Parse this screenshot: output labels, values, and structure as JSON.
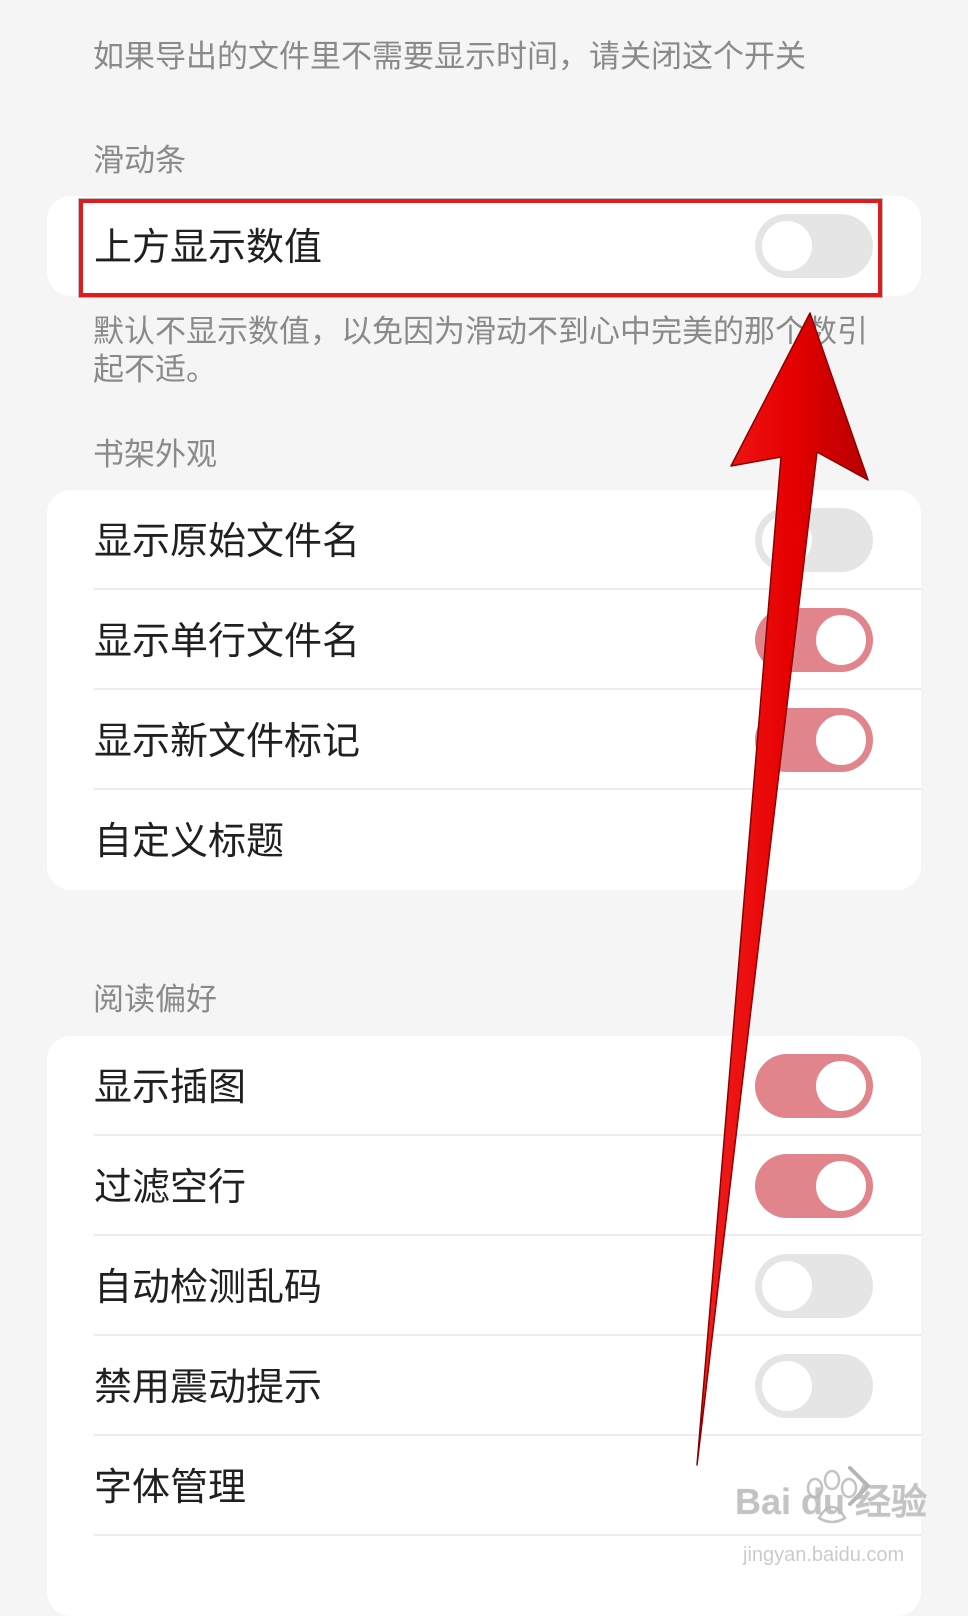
{
  "top_note": "如果导出的文件里不需要显示时间，请关闭这个开关",
  "slider_section": {
    "title": "滑动条",
    "rows": [
      {
        "label": "上方显示数值",
        "toggle": "off"
      }
    ],
    "note": "默认不显示数值，以免因为滑动不到心中完美的那个数引起不适。"
  },
  "bookshelf_section": {
    "title": "书架外观",
    "rows": [
      {
        "label": "显示原始文件名",
        "toggle": "off"
      },
      {
        "label": "显示单行文件名",
        "toggle": "on"
      },
      {
        "label": "显示新文件标记",
        "toggle": "on"
      },
      {
        "label": "自定义标题",
        "toggle": null
      }
    ]
  },
  "reading_section": {
    "title": "阅读偏好",
    "rows": [
      {
        "label": "显示插图",
        "toggle": "on"
      },
      {
        "label": "过滤空行",
        "toggle": "on"
      },
      {
        "label": "自动检测乱码",
        "toggle": "off"
      },
      {
        "label": "禁用震动提示",
        "toggle": "off"
      },
      {
        "label": "字体管理",
        "toggle": null,
        "icon": "chevron-right-icon"
      }
    ]
  },
  "watermark": {
    "title": "Bai du 经验",
    "subtitle": "jingyan.baidu.com"
  },
  "colors": {
    "background": "#f5f5f5",
    "card": "#ffffff",
    "toggle_on": "#e1848c",
    "toggle_off": "#e5e5e5",
    "highlight": "#e11b1b"
  }
}
